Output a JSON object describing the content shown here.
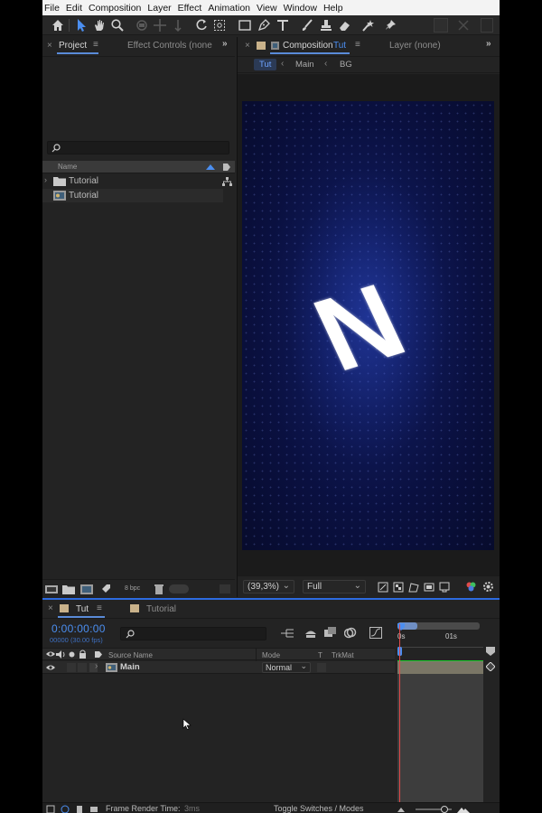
{
  "menu": [
    "File",
    "Edit",
    "Composition",
    "Layer",
    "Effect",
    "Animation",
    "View",
    "Window",
    "Help"
  ],
  "project_panel": {
    "tabs": [
      "Project",
      "Effect Controls (none"
    ],
    "column_name": "Name",
    "items": [
      {
        "label": "Tutorial",
        "type": "folder"
      },
      {
        "label": "Tutorial",
        "type": "composition"
      }
    ],
    "bpc": "8 bpc"
  },
  "comp_panel": {
    "tab_prefix": "Composition",
    "tab_name": "Tut",
    "layer_tab": "Layer  (none)",
    "breadcrumbs": [
      "Tut",
      "Main",
      "BG"
    ],
    "zoom": "(39,3%)",
    "resolution": "Full",
    "canvas_letter": "N"
  },
  "timeline": {
    "tab_active": "Tut",
    "tab_other": "Tutorial",
    "timecode": "0:00:00:00",
    "frame_info": "00000 (30.00 fps)",
    "columns": {
      "source_name": "Source Name",
      "mode": "Mode",
      "t": "T",
      "trkmat": "TrkMat"
    },
    "layer": {
      "name": "Main",
      "mode": "Normal"
    },
    "ruler_labels": [
      "0s",
      "01s"
    ],
    "frame_render_label": "Frame Render Time:",
    "frame_render_value": "3ms",
    "toggle_label": "Toggle Switches / Modes"
  },
  "colors": {
    "accent": "#2d6be0",
    "playhead": "#e24a4a",
    "work_area": "#19c92b",
    "composition_bg": "#0a1040"
  }
}
